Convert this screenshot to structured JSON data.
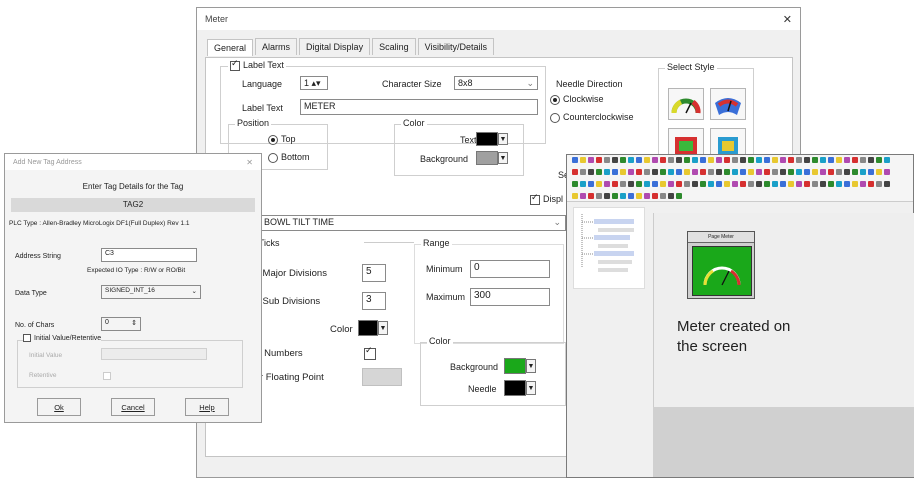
{
  "meter_dialog": {
    "title": "Meter",
    "tabs": [
      "General",
      "Alarms",
      "Digital Display",
      "Scaling",
      "Visibility/Details"
    ],
    "label_text_check": "Label Text",
    "language_label": "Language",
    "language_value": "1",
    "character_size_label": "Character Size",
    "character_size_value": "8x8",
    "label_text_label": "Label Text",
    "label_text_value": "METER",
    "position_group": "Position",
    "position_top": "Top",
    "position_bottom": "Bottom",
    "color_group": "Color",
    "text_label": "Text",
    "background_label": "Background",
    "needle_direction_label": "Needle Direction",
    "clockwise": "Clockwise",
    "counterclockwise": "Counterclockwise",
    "select_style_label": "Select Style",
    "sel_partial": "Sel",
    "sel_partial_2": "S",
    "display_partial": "Displ",
    "tag_value": "BOWL TILT TIME",
    "ticks_label": "w Ticks",
    "major_divisions_label": "of Major Divisions",
    "major_divisions_value": "5",
    "sub_divisions_label": "of Sub Divisions",
    "sub_divisions_value": "3",
    "tick_color_label": "Color",
    "tick_numbers_label": "ck Numbers",
    "floating_point_label": "for Floating Point",
    "range_group": "Range",
    "minimum_label": "Minimum",
    "minimum_value": "0",
    "maximum_label": "Maximum",
    "maximum_value": "300",
    "color2_group": "Color",
    "background2_label": "Background",
    "needle_label": "Needle"
  },
  "tag_dialog": {
    "title": "Add New Tag Address",
    "header": "Enter Tag Details for the Tag",
    "tag_name": "TAG2",
    "plc_type": "PLC Type : Allen-Bradley MicroLogix DF1(Full Duplex) Rev 1.1",
    "address_string_label": "Address String",
    "address_string_value": "C3",
    "expected_io": "Expected IO Type : R/W or RO/Bit",
    "data_type_label": "Data Type",
    "data_type_value": "SIGNED_INT_16",
    "no_of_chars_label": "No. of Chars",
    "no_of_chars_value": "0",
    "initial_value_check": "Initial Value/Retentive",
    "initial_value_label": "Initial Value",
    "retentive_label": "Retentive",
    "ok": "Ok",
    "cancel": "Cancel",
    "help": "Help"
  },
  "editor": {
    "meter_title": "Page Meter",
    "caption_line1": "Meter created on",
    "caption_line2": "the screen"
  },
  "colors": {
    "dialog_bg": "#f0f0f0",
    "meter_green": "#1aa81a",
    "swatch_black": "#000000",
    "swatch_gray": "#a0a0a0"
  }
}
